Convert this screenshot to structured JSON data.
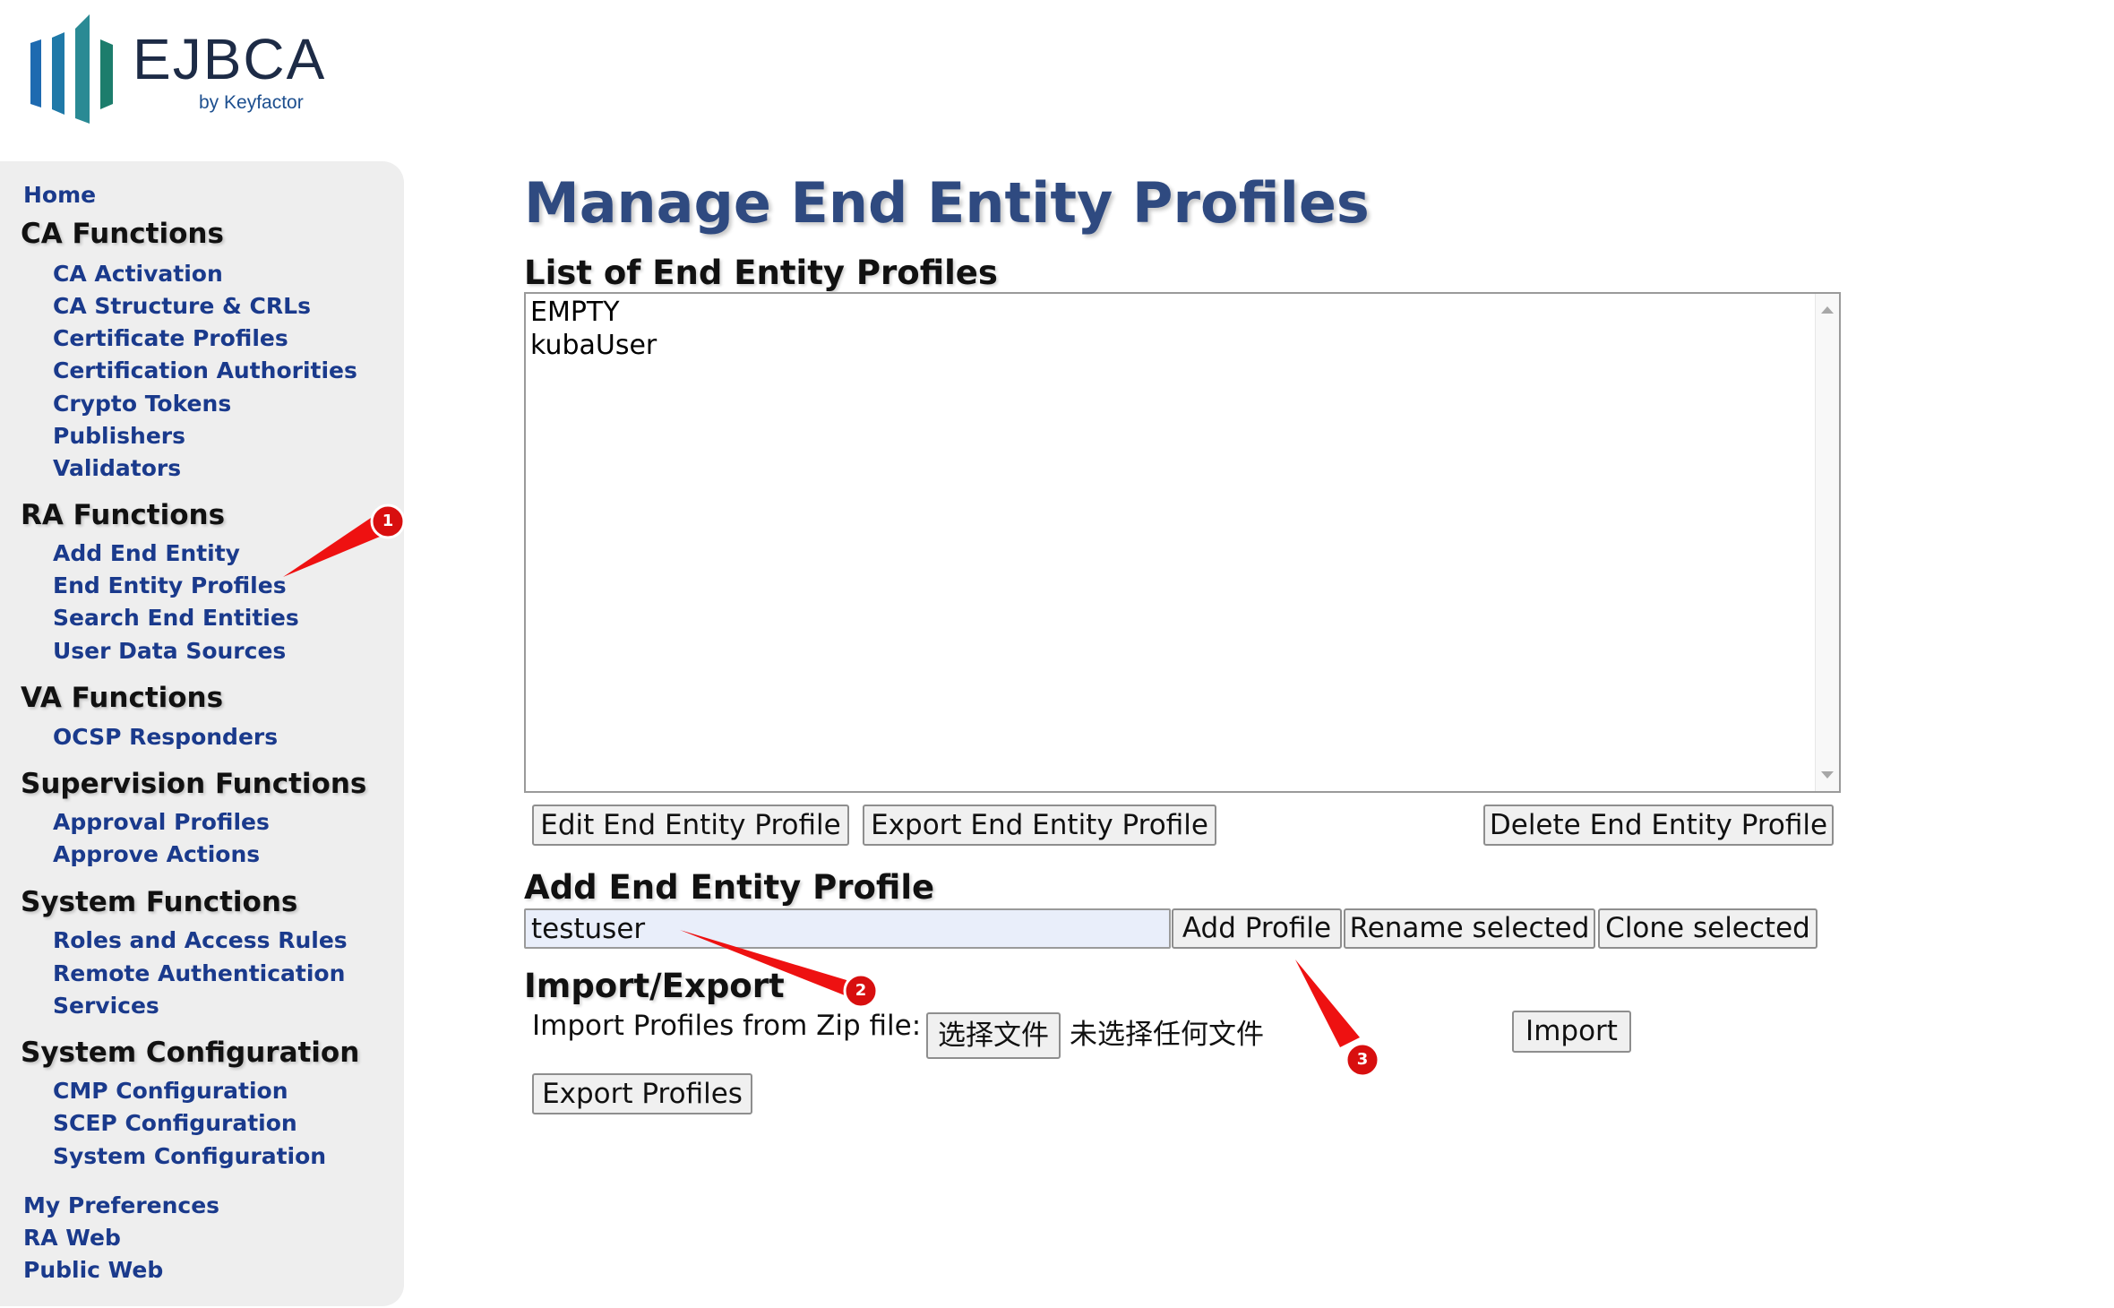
{
  "logo": {
    "name": "EJBCA",
    "tagline": "by Keyfactor",
    "colors": {
      "bar1": "#1e6ab0",
      "bar2": "#2a8a94",
      "bar3": "#1c7d6c",
      "text": "#1d2b46"
    }
  },
  "sidebar": {
    "home": "Home",
    "ca_functions": {
      "title": "CA Functions",
      "items": [
        "CA Activation",
        "CA Structure & CRLs",
        "Certificate Profiles",
        "Certification Authorities",
        "Crypto Tokens",
        "Publishers",
        "Validators"
      ]
    },
    "ra_functions": {
      "title": "RA Functions",
      "items": [
        "Add End Entity",
        "End Entity Profiles",
        "Search End Entities",
        "User Data Sources"
      ]
    },
    "va_functions": {
      "title": "VA Functions",
      "items": [
        "OCSP Responders"
      ]
    },
    "supervision_functions": {
      "title": "Supervision Functions",
      "items": [
        "Approval Profiles",
        "Approve Actions"
      ]
    },
    "system_functions": {
      "title": "System Functions",
      "items": [
        "Roles and Access Rules",
        "Remote Authentication",
        "Services"
      ]
    },
    "system_configuration": {
      "title": "System Configuration",
      "items": [
        "CMP Configuration",
        "SCEP Configuration",
        "System Configuration"
      ]
    },
    "footer_links": [
      "My Preferences",
      "RA Web",
      "Public Web"
    ]
  },
  "main": {
    "title": "Manage End Entity Profiles",
    "list_heading": "List of End Entity Profiles",
    "profiles": [
      "EMPTY",
      "kubaUser"
    ],
    "edit_button": "Edit End Entity Profile",
    "export_button": "Export End Entity Profile",
    "delete_button": "Delete End Entity Profile",
    "add_heading": "Add End Entity Profile",
    "profile_name_value": "testuser",
    "add_button": "Add Profile",
    "rename_button": "Rename selected",
    "clone_button": "Clone selected",
    "import_export_heading": "Import/Export",
    "import_label": "Import Profiles from Zip file:",
    "choose_file_button": "选择文件",
    "no_file_text": "未选择任何文件",
    "import_button": "Import",
    "export_profiles_button": "Export Profiles"
  },
  "annotations": {
    "color": "#ee1111",
    "markers": [
      "1",
      "2",
      "3"
    ]
  },
  "colors": {
    "link": "#1a3a8c",
    "title": "#2f4a80",
    "sidebar_bg": "#eeeeee",
    "input_bg": "#e9eefa"
  }
}
